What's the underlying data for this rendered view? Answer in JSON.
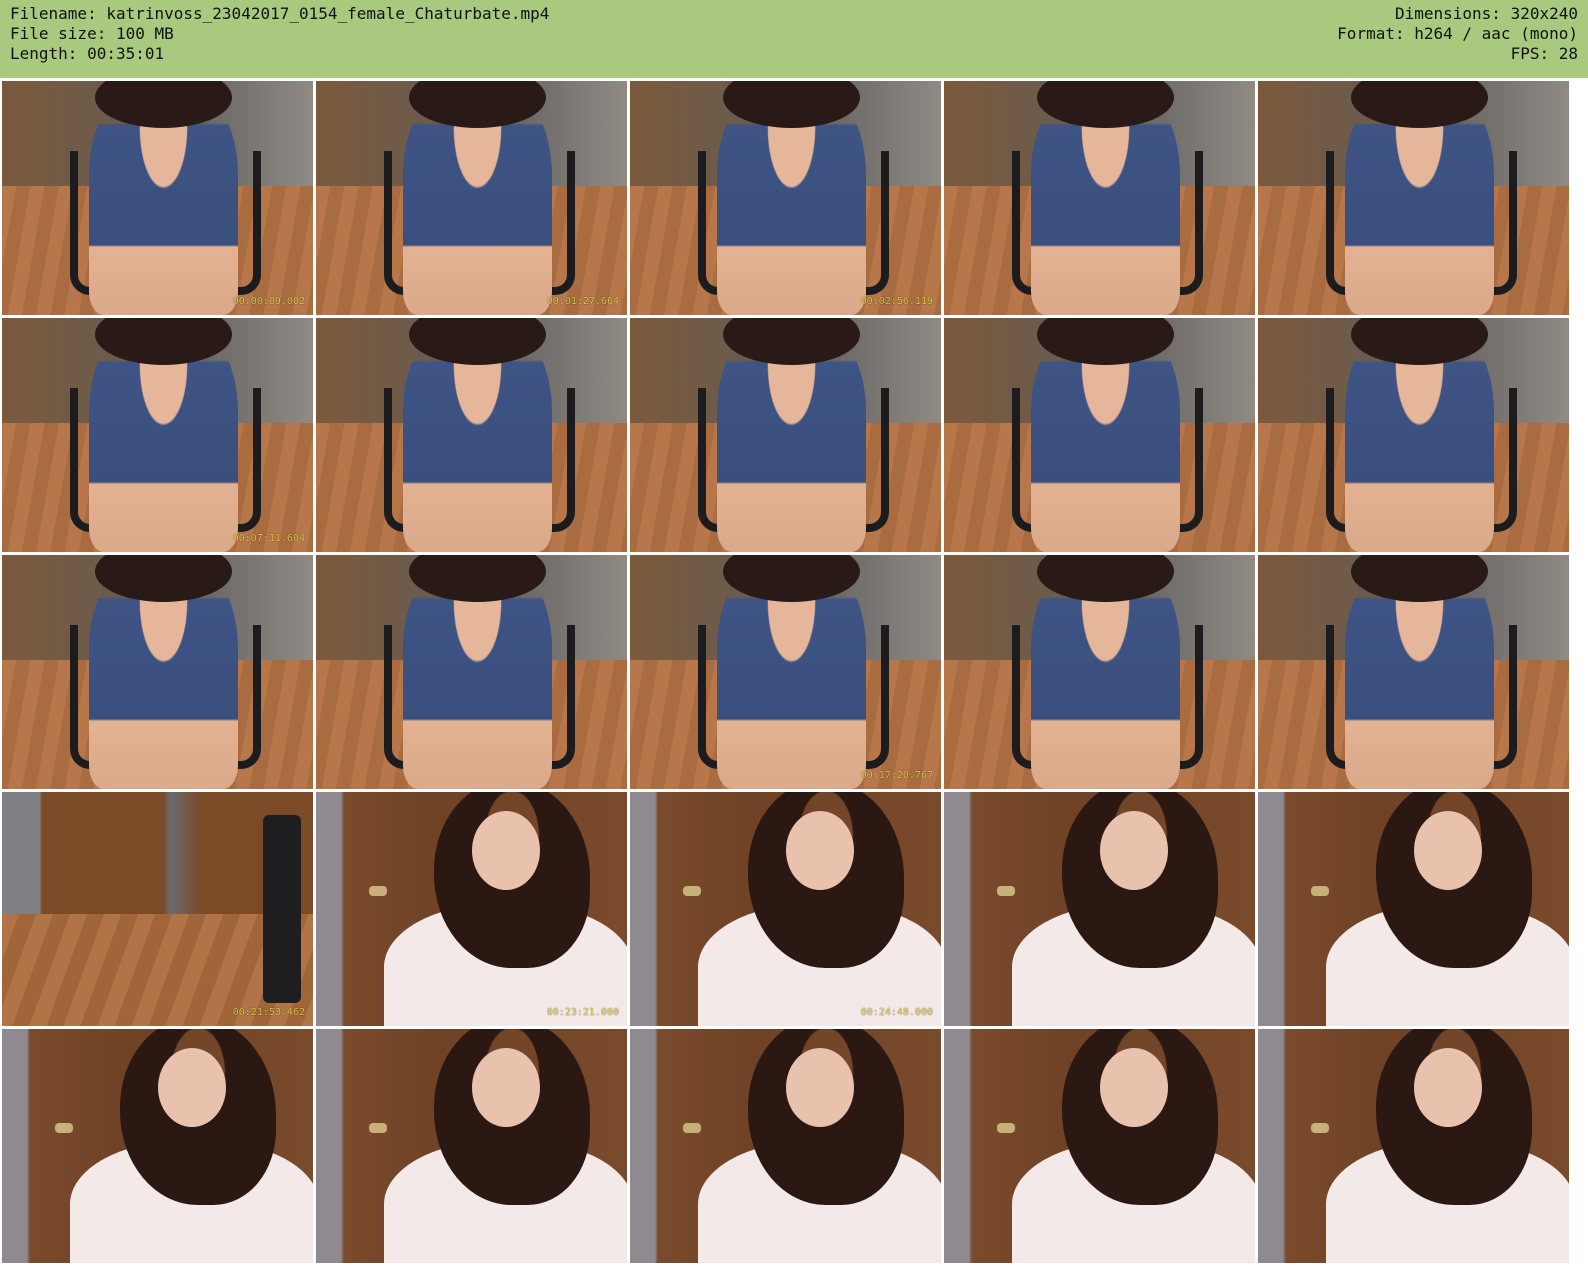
{
  "header": {
    "filename": "Filename: katrinvoss_23042017_0154_female_Chaturbate.mp4",
    "filesize": "File size: 100 MB",
    "length": "Length: 00:35:01",
    "dimensions": "Dimensions: 320x240",
    "format": "Format: h264 / aac (mono)",
    "fps": "FPS: 28"
  },
  "colors": {
    "header_bg": "#a9c97e",
    "timestamp": "#e8d84a"
  },
  "thumbnails": [
    {
      "scene": "blue",
      "timestamp": "00:00:09.002"
    },
    {
      "scene": "blue",
      "timestamp": "00:01:27.664"
    },
    {
      "scene": "blue",
      "timestamp": "00:02:56.119"
    },
    {
      "scene": "blue",
      "timestamp": ""
    },
    {
      "scene": "blue",
      "timestamp": ""
    },
    {
      "scene": "blue",
      "timestamp": "00:07:11.604"
    },
    {
      "scene": "blue",
      "timestamp": ""
    },
    {
      "scene": "blue",
      "timestamp": ""
    },
    {
      "scene": "blue",
      "timestamp": ""
    },
    {
      "scene": "blue",
      "timestamp": ""
    },
    {
      "scene": "blue",
      "timestamp": ""
    },
    {
      "scene": "blue",
      "timestamp": ""
    },
    {
      "scene": "blue",
      "timestamp": "00:17:20.767"
    },
    {
      "scene": "blue",
      "timestamp": ""
    },
    {
      "scene": "blue",
      "timestamp": ""
    },
    {
      "scene": "room",
      "timestamp": "00:21:53.462"
    },
    {
      "scene": "pink",
      "timestamp": "00:23:21.000"
    },
    {
      "scene": "pink",
      "timestamp": "00:24:48.000"
    },
    {
      "scene": "pink",
      "timestamp": ""
    },
    {
      "scene": "pink",
      "timestamp": ""
    },
    {
      "scene": "pink",
      "timestamp": ""
    },
    {
      "scene": "pink",
      "timestamp": ""
    },
    {
      "scene": "pink",
      "timestamp": ""
    },
    {
      "scene": "pink",
      "timestamp": ""
    },
    {
      "scene": "pink",
      "timestamp": ""
    }
  ]
}
